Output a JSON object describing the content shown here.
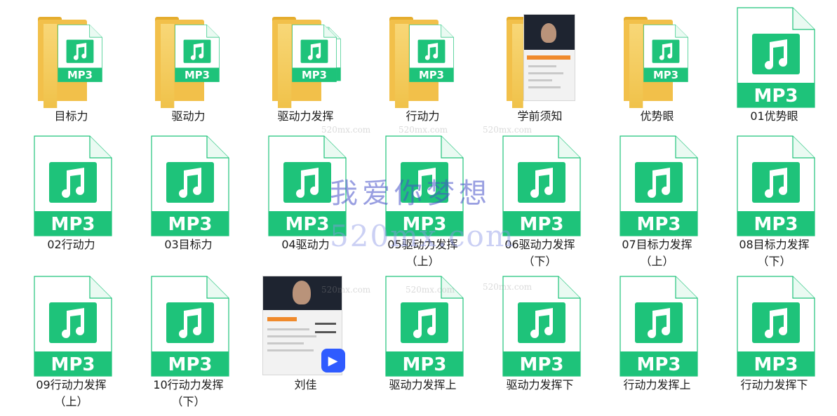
{
  "colors": {
    "mp3_green": "#1ec37a",
    "folder_yellow": "#f2c04a"
  },
  "icons": {
    "music": "music-note-icon",
    "folder": "folder-icon",
    "video": "video-app-icon"
  },
  "watermark": {
    "cn": "我爱你梦想",
    "domain": "520mx.com",
    "small": "520mx.com"
  },
  "rows": [
    [
      {
        "name": "目标力",
        "type": "folder"
      },
      {
        "name": "驱动力",
        "type": "folder"
      },
      {
        "name": "驱动力发挥",
        "type": "folder-multi"
      },
      {
        "name": "行动力",
        "type": "folder"
      },
      {
        "name": "学前须知",
        "type": "folder-photo"
      },
      {
        "name": "优势眼",
        "type": "folder"
      },
      {
        "name": "01优势眼",
        "type": "mp3"
      }
    ],
    [
      {
        "name": "02行动力",
        "type": "mp3"
      },
      {
        "name": "03目标力",
        "type": "mp3"
      },
      {
        "name": "04驱动力",
        "type": "mp3"
      },
      {
        "name": "05驱动力发挥（上）",
        "type": "mp3"
      },
      {
        "name": "06驱动力发挥（下）",
        "type": "mp3"
      },
      {
        "name": "07目标力发挥（上）",
        "type": "mp3"
      },
      {
        "name": "08目标力发挥（下）",
        "type": "mp3"
      }
    ],
    [
      {
        "name": "09行动力发挥（上）",
        "type": "mp3"
      },
      {
        "name": "10行动力发挥（下）",
        "type": "mp3"
      },
      {
        "name": "刘佳",
        "type": "video"
      },
      {
        "name": "驱动力发挥上",
        "type": "mp3"
      },
      {
        "name": "驱动力发挥下",
        "type": "mp3"
      },
      {
        "name": "行动力发挥上",
        "type": "mp3"
      },
      {
        "name": "行动力发挥下",
        "type": "mp3"
      }
    ]
  ],
  "mp3_label": "MP3",
  "video_badge": "▶"
}
